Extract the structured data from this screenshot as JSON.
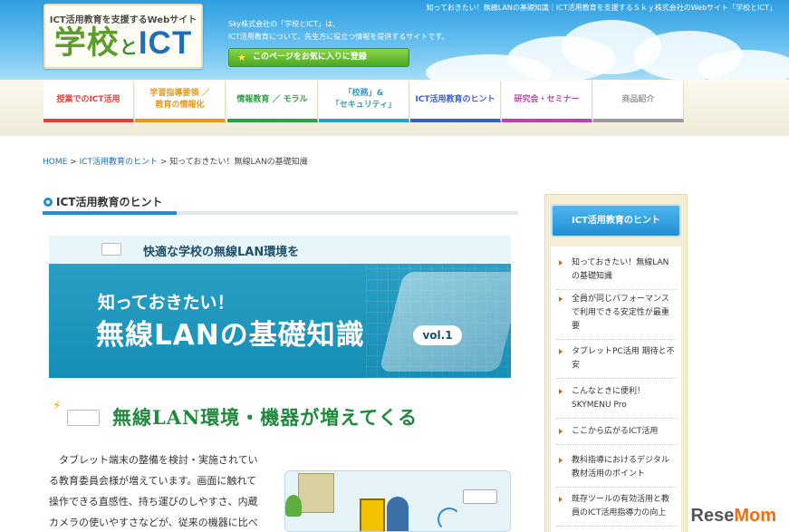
{
  "header": {
    "logo_sub": "ICT活用教育を支援するWebサイト",
    "logo_main_a": "学校",
    "logo_main_to": "と",
    "logo_main_b": "ICT",
    "top_text": "知っておきたい！無線LANの基礎知識｜ICT活用教育を支援するＳｋｙ株式会社のWebサイト「学校とICT」",
    "desc_line1": "Sky株式会社の「学校とICT」は、",
    "desc_line2": "ICT活用教育について、先生方に役立つ情報を提供するサイトです。",
    "favorite_label": "このページをお気に入りに登録",
    "star_icon": "star-icon"
  },
  "nav": [
    {
      "label": "授業でのICT活用",
      "color": "#e0423a"
    },
    {
      "label": "学習指導要領 ／\n教育の情報化",
      "color": "#e39a1b"
    },
    {
      "label": "情報教育 ／ モラル",
      "color": "#2f9e4a"
    },
    {
      "label": "「校務」&\n「セキュリティ」",
      "color": "#2ca0bd"
    },
    {
      "label": "ICT活用教育のヒント",
      "color": "#3d5fbf"
    },
    {
      "label": "研究会・セミナー",
      "color": "#b34aa6"
    },
    {
      "label": "商品紹介",
      "color": "#9a9a9a"
    }
  ],
  "breadcrumb": {
    "home": "HOME",
    "sep1": " > ",
    "section": "ICT活用教育のヒント",
    "sep2": " > ",
    "current": "知っておきたい！無線LANの基礎知識"
  },
  "section_title": "ICT活用教育のヒント",
  "banner": {
    "top": "快適な学校の無線LAN環境を",
    "line1": "知っておきたい！",
    "line2": "無線LANの基礎知識",
    "vol": "vol.1"
  },
  "sub_heading": "無線LAN環境・機器が増えてくる",
  "body": {
    "line1": "　タブレット端末の整備を検討・実施されてい",
    "line2": "る教育委員会様が増えています。画面に触れて",
    "line3": "操作できる直感性、持ち運びのしやすさ、内蔵",
    "line4": "カメラの使いやすさなどが、従来の機器に比べ"
  },
  "sidebar": {
    "title": "ICT活用教育のヒント",
    "items": [
      "知っておきたい！無線LAN\nの基礎知識",
      "全員が同じパフォーマンス\nで利用できる安定性が最重\n要",
      "タブレットPC活用 期待と不\n安",
      "こんなときに便利！\nSKYMENU Pro",
      "ここから広がるICT活用",
      "教科指導におけるデジタル\n教材活用のポイント",
      "既存ツールの有効活用と教\n員のICT活用指導力の向上"
    ]
  },
  "watermark": {
    "a": "Rese",
    "b": "Mom"
  }
}
